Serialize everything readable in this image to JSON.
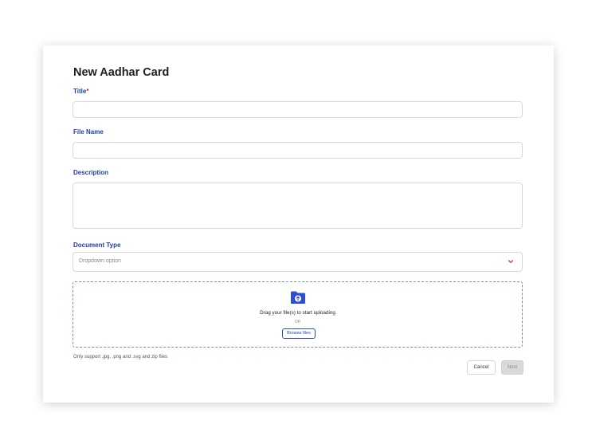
{
  "modal": {
    "heading": "New Aadhar Card",
    "title_label": "Title",
    "required_marker": "*",
    "title_value": "",
    "file_name_label": "File Name",
    "file_name_value": "",
    "description_label": "Description",
    "description_value": "",
    "document_type_label": "Document Type",
    "document_type_placeholder": "Dropdown option",
    "upload": {
      "drag_text": "Drag your file(s) to start uploading",
      "or_text": "OR",
      "browse_label": "Browse files",
      "support_text": "Only support .jpg, .png and .svg and zip files"
    },
    "cancel_label": "Cancel",
    "next_label": "Next"
  },
  "colors": {
    "label_blue": "#1f3fa6",
    "required_red": "#d32f2f",
    "chevron_red": "#c0392b",
    "folder_blue": "#2b4fd8",
    "dropzone_border": "#6f8ed8"
  },
  "icons": {
    "chevron": "chevron-down-icon",
    "folder": "folder-upload-icon"
  }
}
